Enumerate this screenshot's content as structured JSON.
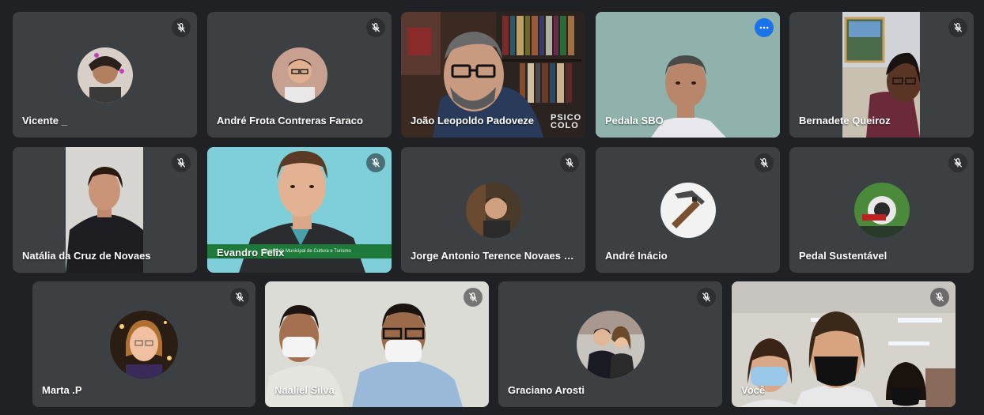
{
  "participants": [
    {
      "name": "Vicente _",
      "muted": true
    },
    {
      "name": "André Frota Contreras Faraco",
      "muted": true
    },
    {
      "name": "João Leopoldo Padoveze",
      "muted": false,
      "bg_text": "PSICO COLO"
    },
    {
      "name": "Pedala SBO",
      "muted": false,
      "active_speaker": true
    },
    {
      "name": "Bernadete Queiroz",
      "muted": true
    },
    {
      "name": "Natália da Cruz de Novaes",
      "muted": true
    },
    {
      "name": "Evandro Felix",
      "muted": true,
      "lower_third": "Secretaria Municipal de Cultura e Turismo"
    },
    {
      "name": "Jorge Antonio Terence Novaes d...",
      "muted": true
    },
    {
      "name": "André Inácio",
      "muted": true
    },
    {
      "name": "Pedal Sustentável",
      "muted": true
    },
    {
      "name": "Marta .P",
      "muted": true
    },
    {
      "name": "Naaliel Silva",
      "muted": true
    },
    {
      "name": "Graciano Arosti",
      "muted": true
    },
    {
      "name": "Você",
      "muted": true
    }
  ],
  "colors": {
    "background": "#202124",
    "tile": "#3c4043",
    "active_border": "#8ab4f8",
    "more_button": "#1a73e8"
  },
  "icons": {
    "mute": "mic-off-icon",
    "more": "more-options-icon"
  }
}
